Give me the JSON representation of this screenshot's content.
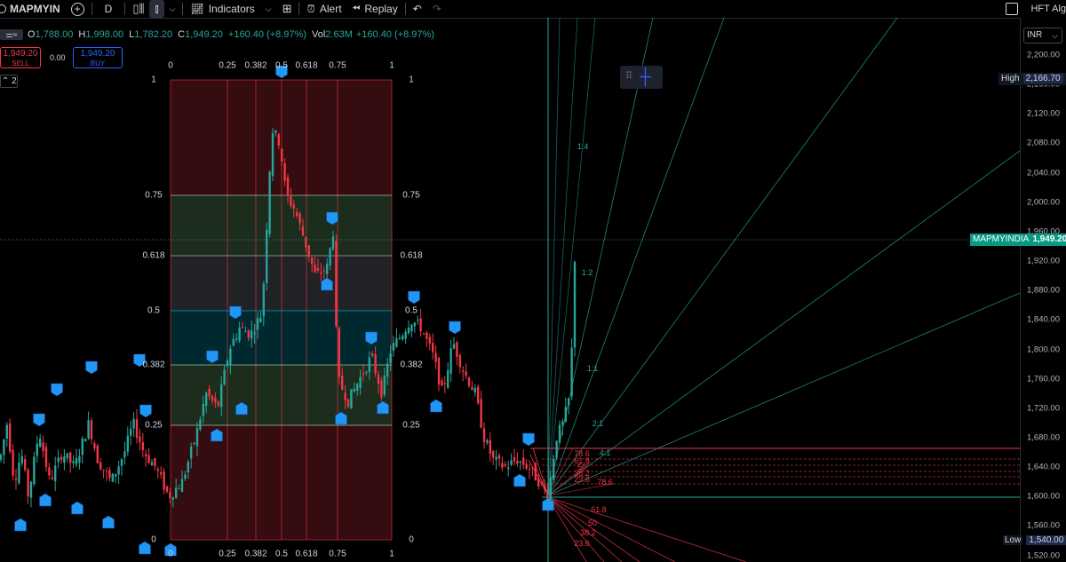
{
  "toolbar": {
    "symbol": "MAPMYIN",
    "add_symbol_icon": "plus-circle-icon",
    "interval": "D",
    "indicators_label": "Indicators",
    "alert_label": "Alert",
    "replay_label": "Replay",
    "right_label": "HFT Alg"
  },
  "legend": {
    "o_label": "O",
    "o": "1,788.00",
    "h_label": "H",
    "h": "1,998.00",
    "l_label": "L",
    "l": "1,782.20",
    "c_label": "C",
    "c": "1,949.20",
    "change": "+160.40 (+8.97%)",
    "vol_label": "Vol",
    "vol": "2.63",
    "vol_unit": "M",
    "vol_change": "+160.40 (+8.97%)"
  },
  "trade": {
    "sell_price": "1,949.20",
    "sell_label": "SELL",
    "spread": "0.00",
    "buy_price": "1,949.20",
    "buy_label": "BUY",
    "collapse_count": "2"
  },
  "price_axis": {
    "currency": "INR",
    "ticks": [
      "2,200.00",
      "2,160.00",
      "2,120.00",
      "2,080.00",
      "2,040.00",
      "2,000.00",
      "1,960.00",
      "1,920.00",
      "1,880.00",
      "1,840.00",
      "1,800.00",
      "1,760.00",
      "1,720.00",
      "1,680.00",
      "1,640.00",
      "1,600.00",
      "1,560.00",
      "1,520.00"
    ],
    "high_label": "High",
    "high_value": "2,166.70",
    "symbol_label": "MAPMYINDIA",
    "current_value": "1,949.20",
    "low_label": "Low",
    "low_value": "1,540.00"
  },
  "fib_box": {
    "top_levels": [
      "0",
      "0.25",
      "0.382",
      "0.5",
      "0.618",
      "0.75",
      "1"
    ],
    "side_levels": [
      "1",
      "0.75",
      "0.618",
      "0.5",
      "0.382",
      "0.25",
      "0"
    ]
  },
  "fan_labels": {
    "green": [
      "1:4",
      "1:2",
      "1:1",
      "2:1",
      "4:1"
    ],
    "red": [
      "78.6",
      "61.8",
      "50",
      "38.2",
      "23.6",
      "78.6",
      "61.8",
      "50",
      "38.2",
      "23.6"
    ]
  },
  "colors": {
    "up": "#26a69a",
    "down": "#f23645",
    "marker": "#2196f3",
    "background": "#000000"
  }
}
